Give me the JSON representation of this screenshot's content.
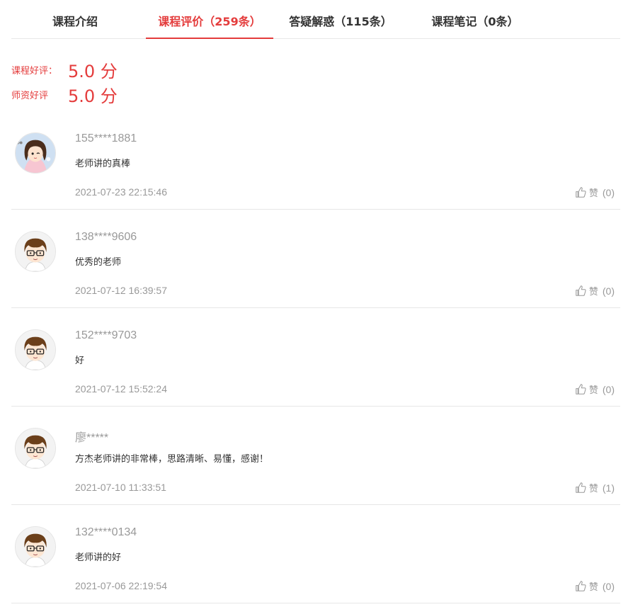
{
  "tabs": [
    {
      "label": "课程介绍",
      "active": false
    },
    {
      "label": "课程评价（259条）",
      "active": true
    },
    {
      "label": "答疑解惑（115条）",
      "active": false
    },
    {
      "label": "课程笔记（0条）",
      "active": false
    }
  ],
  "scores": {
    "course": {
      "label": "课程好评：",
      "value": "5.0 分"
    },
    "teacher": {
      "label": "师资好评",
      "value": "5.0 分"
    }
  },
  "like_label": "赞",
  "reviews": [
    {
      "username": "155****1881",
      "content": "老师讲的真棒",
      "time": "2021-07-23 22:15:46",
      "likes": "(0)",
      "avatar": "girl-avatar"
    },
    {
      "username": "138****9606",
      "content": "优秀的老师",
      "time": "2021-07-12 16:39:57",
      "likes": "(0)",
      "avatar": "boy-avatar"
    },
    {
      "username": "152****9703",
      "content": "好",
      "time": "2021-07-12 15:52:24",
      "likes": "(0)",
      "avatar": "boy-avatar"
    },
    {
      "username": "廖*****",
      "content": "方杰老师讲的非常棒，思路清晰、易懂，感谢！",
      "time": "2021-07-10 11:33:51",
      "likes": "(1)",
      "avatar": "boy-avatar"
    },
    {
      "username": "132****0134",
      "content": "老师讲的好",
      "time": "2021-07-06 22:19:54",
      "likes": "(0)",
      "avatar": "boy-avatar"
    }
  ],
  "colors": {
    "accent": "#e43c3c",
    "muted": "#999999",
    "divider": "#e6e6e6"
  }
}
